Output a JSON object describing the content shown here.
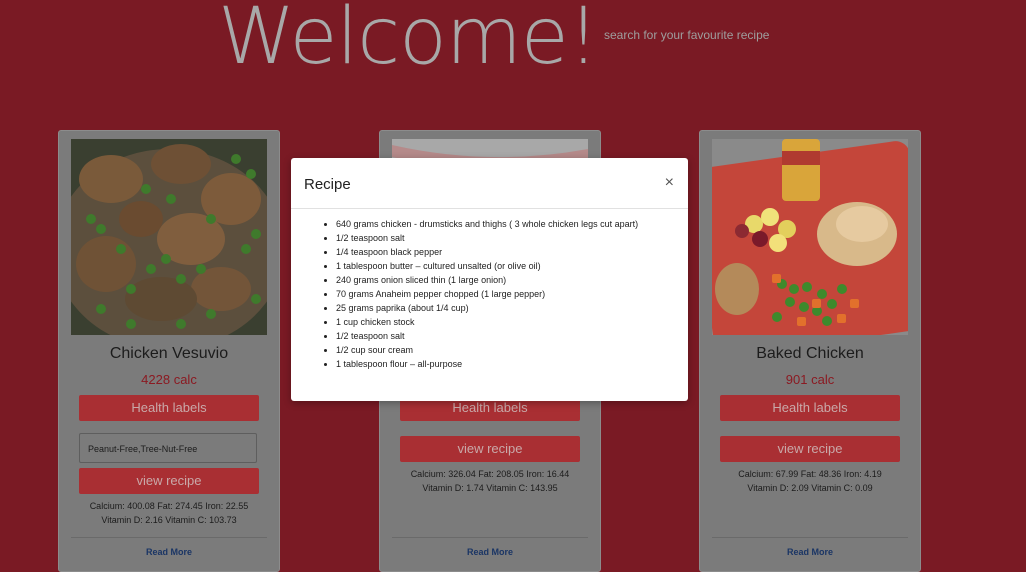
{
  "header": {
    "welcome": "Welcome!",
    "subtitle": "search for your favourite recipe"
  },
  "cards": [
    {
      "title": "Chicken Vesuvio",
      "calories": "4228 calc",
      "health_labels_button": "Health labels",
      "health_labels_value": "Peanut-Free,Tree-Nut-Free",
      "view_recipe_button": "view recipe",
      "nutrients_line1": "Calcium: 400.08   Fat: 274.45   Iron: 22.55",
      "nutrients_line2": "Vitamin D: 2.16   Vitamin C: 103.73",
      "read_more": "Read More"
    },
    {
      "title": "",
      "calories": "",
      "health_labels_button": "Health labels",
      "view_recipe_button": "view recipe",
      "nutrients_line1": "Calcium: 326.04   Fat: 208.05   Iron: 16.44",
      "nutrients_line2": "Vitamin D: 1.74   Vitamin C: 143.95",
      "read_more": "Read More"
    },
    {
      "title": "Baked Chicken",
      "calories": "901 calc",
      "health_labels_button": "Health labels",
      "view_recipe_button": "view recipe",
      "nutrients_line1": "Calcium: 67.99   Fat: 48.36   Iron: 4.19",
      "nutrients_line2": "Vitamin D: 2.09   Vitamin C: 0.09",
      "read_more": "Read More"
    }
  ],
  "modal": {
    "title": "Recipe",
    "close": "×",
    "ingredients": [
      "640 grams chicken - drumsticks and thighs ( 3 whole chicken legs cut apart)",
      "1/2 teaspoon salt",
      "1/4 teaspoon black pepper",
      "1 tablespoon butter – cultured unsalted (or olive oil)",
      "240 grams onion sliced thin (1 large onion)",
      "70 grams Anaheim pepper chopped (1 large pepper)",
      "25 grams paprika (about 1/4 cup)",
      "1 cup chicken stock",
      "1/2 teaspoon salt",
      "1/2 cup sour cream",
      "1 tablespoon flour – all-purpose"
    ]
  },
  "colors": {
    "background": "#7a1a24",
    "button": "#a92f33",
    "calories": "#8b1a22",
    "link": "#1a3565"
  }
}
